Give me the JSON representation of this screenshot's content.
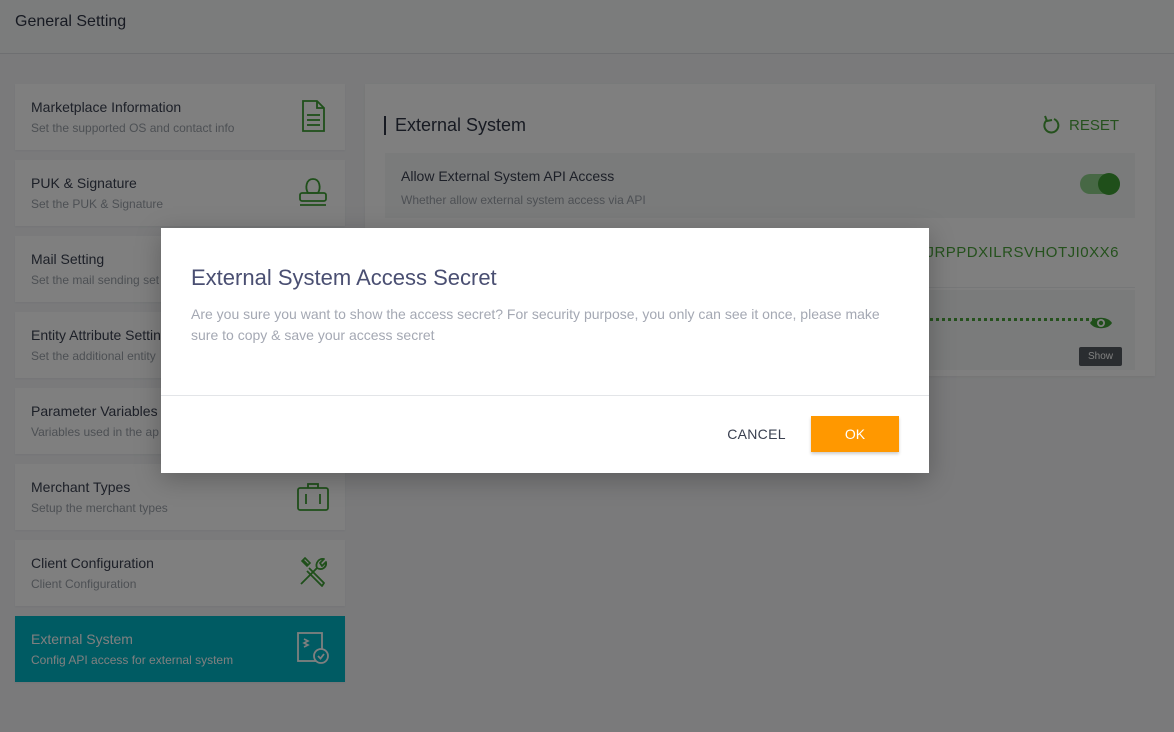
{
  "header": {
    "title": "General Setting"
  },
  "sidebar": {
    "items": [
      {
        "title": "Marketplace Information",
        "subtitle": "Set the supported OS and contact info"
      },
      {
        "title": "PUK & Signature",
        "subtitle": "Set the PUK & Signature"
      },
      {
        "title": "Mail Setting",
        "subtitle": "Set the mail sending set"
      },
      {
        "title": "Entity Attribute Settin",
        "subtitle": "Set the additional entity"
      },
      {
        "title": "Parameter Variables",
        "subtitle": "Variables used in the ap"
      },
      {
        "title": "Merchant Types",
        "subtitle": "Setup the merchant types"
      },
      {
        "title": "Client Configuration",
        "subtitle": "Client Configuration"
      },
      {
        "title": "External System",
        "subtitle": "Config API access for external system"
      }
    ]
  },
  "panel": {
    "title": "External System",
    "reset_label": "RESET",
    "api_access": {
      "title": "Allow External System API Access",
      "subtitle": "Whether allow external system access via API",
      "enabled": true
    },
    "access_key_value": "JRPPDXILRSVHOTJI0XX6",
    "show_tooltip": "Show"
  },
  "dialog": {
    "title": "External System Access Secret",
    "body": "Are you sure you want to show the access secret? For security purpose, you only can see it once, please make sure to copy & save your access secret",
    "cancel_label": "CANCEL",
    "ok_label": "OK"
  },
  "colors": {
    "accent_green": "#4aa33a",
    "active_item": "#00b6c7",
    "ok_button": "#ff9800"
  },
  "icons": {
    "reset": "reset-icon",
    "visibility": "eye-icon"
  }
}
